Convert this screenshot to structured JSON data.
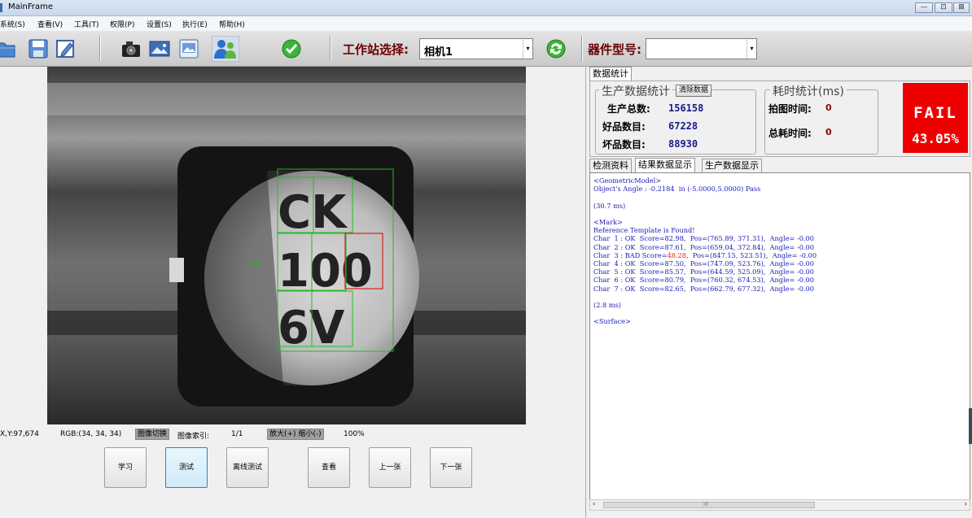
{
  "window": {
    "title": "MainFrame",
    "controls": [
      "—",
      "⊡",
      "⊠"
    ]
  },
  "menu": [
    "系统(S)",
    "查看(V)",
    "工具(T)",
    "权限(P)",
    "设置(S)",
    "执行(E)",
    "帮助(H)"
  ],
  "toolbar": {
    "station_label": "工作站选择:",
    "station_value": "相机1",
    "device_label": "器件型号:",
    "device_value": ""
  },
  "image": {
    "marking_lines": [
      "CK",
      "100",
      "6V"
    ],
    "bad_char_color": "#d42020",
    "box_color": "#22bb22"
  },
  "status": {
    "xy": "X,Y:97,674",
    "rgb": "RGB:(34, 34, 34)",
    "switch_btn": "图像切换",
    "index_label": "图像索引:",
    "index_value": "1/1",
    "zoom_btn": "放大(+)  缩小(-)",
    "zoom_value": "100%"
  },
  "actions": [
    "学习",
    "测试",
    "离线测试",
    "查看",
    "上一张",
    "下一张"
  ],
  "right": {
    "top_tab": "数据统计",
    "production": {
      "title": "生产数据统计",
      "clear_btn": "清除数据",
      "total_label": "生产总数:",
      "total": "156158",
      "good_label": "好品数目:",
      "good": "67228",
      "bad_label": "坏品数目:",
      "bad": "88930"
    },
    "timing": {
      "title": "耗时统计(ms)",
      "grab_label": "拍图时间:",
      "grab": "0",
      "total_label": "总耗时间:",
      "total": "0"
    },
    "result": {
      "status": "FAIL",
      "rate": "43.05%",
      "color": "#ee0000"
    },
    "tabs": [
      "检测资料",
      "结果数据显示",
      "生产数据显示"
    ],
    "log": [
      "<GeometricModel>",
      "Object's Angle : -0.2184  in (-5.0000,5.0000) Pass",
      "",
      "(30.7 ms)",
      "",
      "<Mark>",
      "Reference Template is Found!",
      "Char  1 : OK  Score=82.98,  Pos=(765.89, 371.31),  Angle= -0.00",
      "Char  2 : OK  Score=87.61,  Pos=(659.04, 372.84),  Angle= -0.00",
      "Char  3 : BAD Score=48.28,  Pos=(847.15, 523.51),  Angle= -0.00",
      "Char  4 : OK  Score=87.50,  Pos=(747.09, 523.76),  Angle= -0.00",
      "Char  5 : OK  Score=85.57,  Pos=(644.59, 525.09),  Angle= -0.00",
      "Char  6 : OK  Score=80.79,  Pos=(760.32, 674.53),  Angle= -0.00",
      "Char  7 : OK  Score=82.65,  Pos=(662.79, 677.32),  Angle= -0.00",
      "",
      "(2.8 ms)",
      "",
      "<Surface>"
    ],
    "bad_score": "48.28",
    "scroll_mark": "III"
  }
}
